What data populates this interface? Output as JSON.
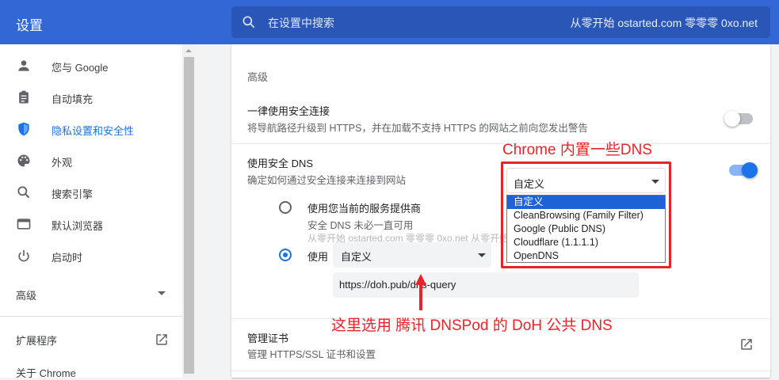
{
  "header": {
    "title": "设置",
    "search_placeholder": "在设置中搜索",
    "search_watermark": "从零开始 ostarted.com 零零零 0xo.net"
  },
  "sidebar": {
    "items": [
      {
        "label": "您与 Google",
        "icon": "person-icon"
      },
      {
        "label": "自动填充",
        "icon": "clipboard-icon"
      },
      {
        "label": "隐私设置和安全性",
        "icon": "shield-icon",
        "active": true
      },
      {
        "label": "外观",
        "icon": "palette-icon"
      },
      {
        "label": "搜索引擎",
        "icon": "search-icon"
      },
      {
        "label": "默认浏览器",
        "icon": "browser-icon"
      },
      {
        "label": "启动时",
        "icon": "power-icon"
      }
    ],
    "advanced_label": "高级",
    "extensions_label": "扩展程序",
    "about_label": "关于 Chrome"
  },
  "main": {
    "section_title": "高级",
    "always_https": {
      "title": "一律使用安全连接",
      "subtitle": "将导航路径升级到 HTTPS，并在加载不支持 HTTPS 的网站之前向您发出警告",
      "enabled": false
    },
    "secure_dns": {
      "title": "使用安全 DNS",
      "subtitle": "确定如何通过安全连接来连接到网站",
      "enabled": true,
      "option_current": {
        "label": "使用您当前的服务提供商",
        "sublabel": "安全 DNS 未必一直可用"
      },
      "option_custom": {
        "label": "使用",
        "select_value": "自定义",
        "url_value": "https://doh.pub/dns-query"
      },
      "watermark": "从零开始 ostarted.com 零零零 0xo.net  从零开始 ostarted.com 零零零 0xo.net"
    },
    "dropdown": {
      "value": "自定义",
      "options": [
        "自定义",
        "CleanBrowsing (Family Filter)",
        "Google (Public DNS)",
        "Cloudflare (1.1.1.1)",
        "OpenDNS"
      ],
      "selected_index": 0
    },
    "certificates": {
      "title": "管理证书",
      "subtitle": "管理 HTTPS/SSL 证书和设置"
    }
  },
  "annotations": {
    "box_label": "Chrome 内置一些DNS",
    "bottom_label": "这里选用 腾讯 DNSPod 的 DoH 公共 DNS"
  },
  "colors": {
    "header_bg": "#3367d6",
    "accent": "#1a73e8",
    "annotation": "#e8242a"
  }
}
